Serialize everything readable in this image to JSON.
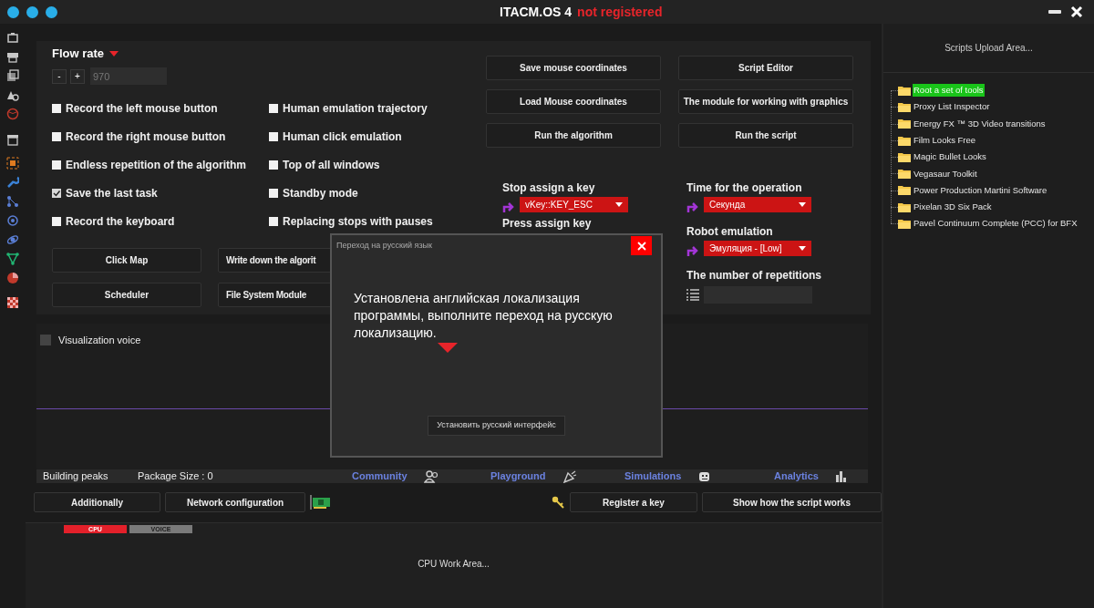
{
  "window": {
    "title": "ITACM.OS 4",
    "status": "not registered"
  },
  "flow_rate": {
    "label": "Flow rate",
    "decrement": "-",
    "increment": "+",
    "value": "970"
  },
  "options": [
    {
      "label": "Record the left mouse button",
      "checked": false
    },
    {
      "label": "Human emulation trajectory",
      "checked": false
    },
    {
      "label": "Record the right mouse button",
      "checked": false
    },
    {
      "label": "Human click emulation",
      "checked": false
    },
    {
      "label": "Endless repetition of the algorithm",
      "checked": false
    },
    {
      "label": "Top of all windows",
      "checked": false
    },
    {
      "label": "Save the last task",
      "checked": true
    },
    {
      "label": "Standby mode",
      "checked": false
    },
    {
      "label": "Record the keyboard",
      "checked": false
    },
    {
      "label": "Replacing stops with pauses",
      "checked": false
    }
  ],
  "left_buttons": [
    "Click Map",
    "Write down the algorit",
    "Scheduler",
    "File System Module"
  ],
  "right_buttons": [
    "Save mouse coordinates",
    "Script Editor",
    "Load Mouse coordinates",
    "The module for working with graphics",
    "Run the algorithm",
    "Run the script"
  ],
  "stop_key": {
    "label": "Stop assign a key",
    "value": "vKey::KEY_ESC"
  },
  "press_key": {
    "label": "Press assign key"
  },
  "time_operation": {
    "label": "Time for the operation",
    "value": "Секунда"
  },
  "robot_emulation": {
    "label": "Robot emulation",
    "value": "Эмуляция - [Low]"
  },
  "repetitions": {
    "label": "The number of repetitions"
  },
  "visualization": {
    "label": "Visualization voice",
    "checked": false
  },
  "status_bar": [
    {
      "kind": "text",
      "label": "Building peaks"
    },
    {
      "kind": "text",
      "label": "Package Size : 0"
    },
    {
      "kind": "link",
      "label": "Community"
    },
    {
      "kind": "link",
      "label": "Playground"
    },
    {
      "kind": "link",
      "label": "Simulations"
    },
    {
      "kind": "link",
      "label": "Analytics"
    }
  ],
  "bottom_buttons": [
    "Additionally",
    "Network configuration",
    "Register a key",
    "Show how the script works"
  ],
  "cpu_panel": {
    "tabs": [
      {
        "label": "CPU",
        "selected": true
      },
      {
        "label": "VOICE",
        "selected": false
      }
    ],
    "text": "CPU Work Area..."
  },
  "scripts_panel": {
    "title": "Scripts Upload Area...",
    "items": [
      {
        "label": "Root a set of tools",
        "selected": true
      },
      {
        "label": "Proxy List Inspector",
        "selected": false
      },
      {
        "label": "Energy FX ™ 3D Video transitions",
        "selected": false
      },
      {
        "label": "Film Looks Free",
        "selected": false
      },
      {
        "label": "Magic Bullet Looks",
        "selected": false
      },
      {
        "label": "Vegasaur Toolkit",
        "selected": false
      },
      {
        "label": "Power Production Martini Software",
        "selected": false
      },
      {
        "label": "Pixelan 3D Six Pack",
        "selected": false
      },
      {
        "label": "Pavel Continuum Complete (PCC) for BFX",
        "selected": false
      }
    ]
  },
  "dialog": {
    "title": "Переход на русский язык",
    "message": "Установлена английская локализация программы, выполните переход на русскую локализацию.",
    "button": "Установить русский интерфейс"
  }
}
